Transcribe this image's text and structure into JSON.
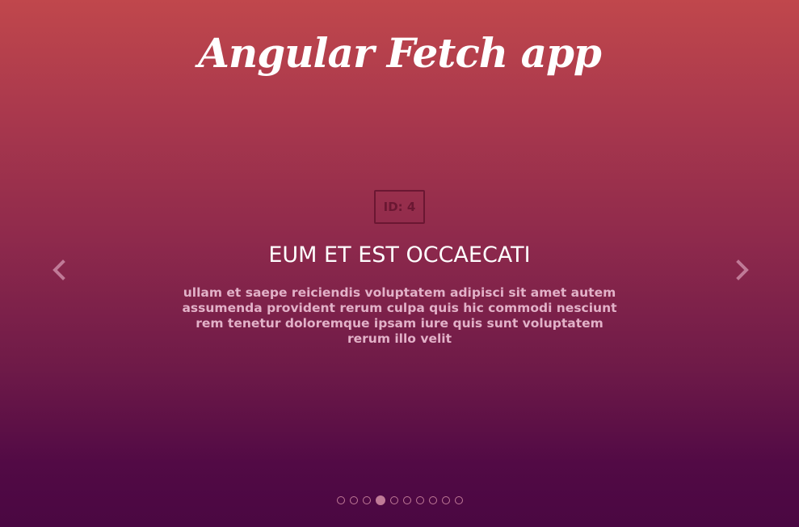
{
  "app": {
    "title": "Angular Fetch app"
  },
  "slide": {
    "id_label": "ID: 4",
    "title": "EUM ET EST OCCAECATI",
    "body": "ullam et saepe reiciendis voluptatem adipisci sit amet autem assumenda provident rerum culpa quis hic commodi nesciunt rem tenetur doloremque ipsam iure quis sunt voluptatem rerum illo velit"
  },
  "carousel": {
    "prev_icon": "chevron-left-icon",
    "next_icon": "chevron-right-icon",
    "total_slides": 10,
    "active_index": 4
  },
  "colors": {
    "gradient_top": "#c0474c",
    "gradient_bottom": "#4a0742",
    "badge": "#6a1732",
    "body_text": "#e2b1c8",
    "indicator": "#c07a97"
  }
}
